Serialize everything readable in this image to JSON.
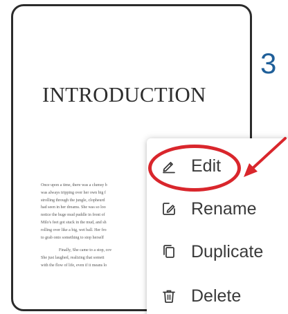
{
  "document": {
    "title": "INTRODUCTION",
    "body_lines": [
      "Once upon a time, there was a clumsy b",
      "was always tripping over her own big f",
      "strolling through the jungle, clopheurd",
      "had seen in her dreams. She was so loo",
      "notice the huge mud puddle in front of",
      "Milo's feet got stuck in the mud, and sh",
      "rolling over like a big, wet ball. Her fro",
      "to grab onto something to stop herself"
    ],
    "body_lines_2": [
      "Finally, She came to a stop, cov",
      "She just laughed, realizing that someti",
      "with the flow of life, even if it means lo"
    ]
  },
  "page_number": "3",
  "menu": {
    "items": [
      {
        "label": "Edit",
        "icon": "pencil-icon"
      },
      {
        "label": "Rename",
        "icon": "rename-icon"
      },
      {
        "label": "Duplicate",
        "icon": "duplicate-icon"
      },
      {
        "label": "Delete",
        "icon": "trash-icon"
      }
    ]
  },
  "colors": {
    "annotation": "#d9262c",
    "page_number": "#1f5f99",
    "menu_text": "#3a3a3a"
  }
}
